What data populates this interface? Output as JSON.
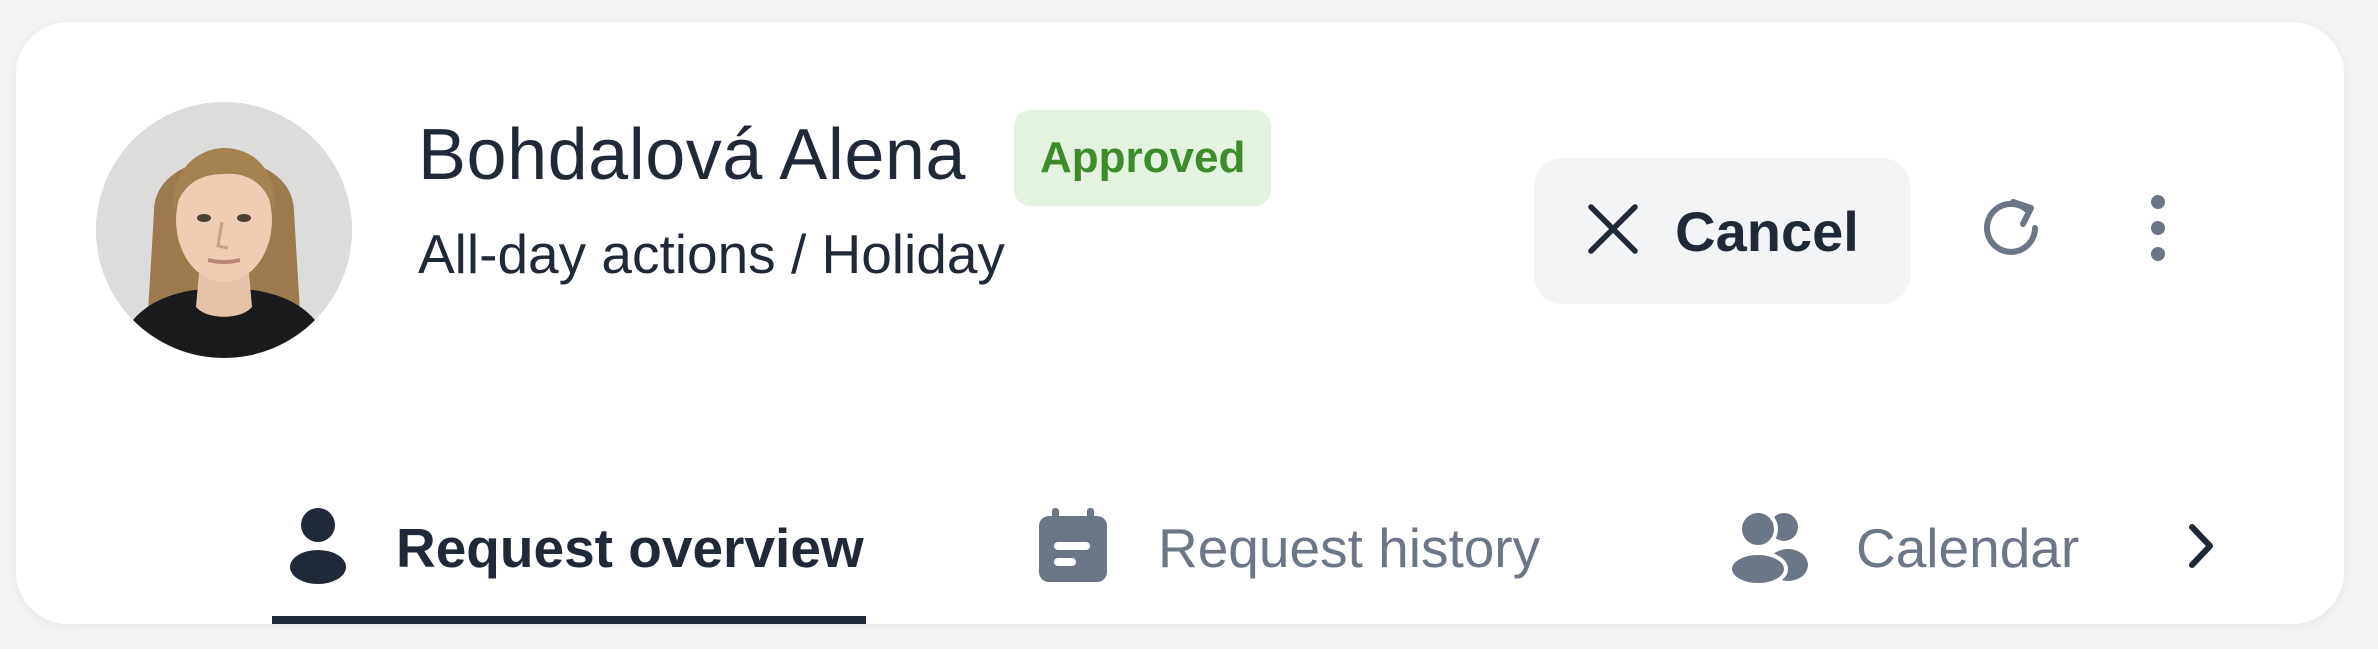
{
  "header": {
    "name": "Bohdalová Alena",
    "status": "Approved",
    "subtitle": "All-day actions / Holiday"
  },
  "actions": {
    "cancel_label": "Cancel",
    "refresh_icon": "refresh-icon",
    "more_icon": "more-vertical-icon"
  },
  "tabs": [
    {
      "label": "Request overview",
      "icon": "user-icon",
      "active": true
    },
    {
      "label": "Request history",
      "icon": "calendar-icon",
      "active": false
    },
    {
      "label": "Calendar",
      "icon": "users-icon",
      "active": false
    }
  ],
  "colors": {
    "text_primary": "#1f2937",
    "text_muted": "#6b7686",
    "badge_bg": "#e4f3df",
    "badge_text": "#3d8b2a",
    "button_bg": "#f3f4f6"
  }
}
